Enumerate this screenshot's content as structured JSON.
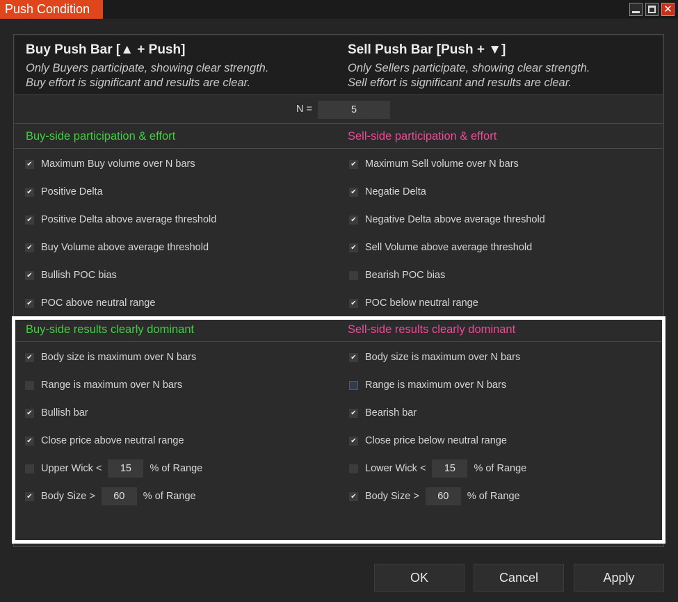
{
  "window": {
    "title": "Push Condition",
    "close_glyph": "✕"
  },
  "buy_header": {
    "title": "Buy Push Bar [▲ + Push]",
    "desc_line1": "Only Buyers participate, showing clear strength.",
    "desc_line2": "Buy effort is significant and results are clear."
  },
  "sell_header": {
    "title": "Sell Push Bar [Push + ▼]",
    "desc_line1": "Only Sellers participate, showing clear strength.",
    "desc_line2": "Sell effort is significant and results are clear."
  },
  "n_field": {
    "label": "N =",
    "value": "5"
  },
  "participation": {
    "buy_title": "Buy-side participation & effort",
    "sell_title": "Sell-side participation & effort",
    "buy_items": [
      {
        "label": "Maximum Buy volume over N bars",
        "checked": true
      },
      {
        "label": "Positive Delta",
        "checked": true
      },
      {
        "label": "Positive Delta above average threshold",
        "checked": true
      },
      {
        "label": "Buy Volume above average threshold",
        "checked": true
      },
      {
        "label": "Bullish POC bias",
        "checked": true
      },
      {
        "label": "POC above neutral range",
        "checked": true
      }
    ],
    "sell_items": [
      {
        "label": "Maximum Sell volume over N bars",
        "checked": true
      },
      {
        "label": "Negatie Delta",
        "checked": true
      },
      {
        "label": "Negative Delta above average threshold",
        "checked": true
      },
      {
        "label": "Sell Volume above average threshold",
        "checked": true
      },
      {
        "label": "Bearish POC bias",
        "checked": false
      },
      {
        "label": "POC below neutral range",
        "checked": true
      }
    ]
  },
  "results": {
    "buy_title": "Buy-side results clearly dominant",
    "sell_title": "Sell-side results clearly dominant",
    "buy_items": [
      {
        "label": "Body size is maximum over N bars",
        "checked": true
      },
      {
        "label": "Range is maximum over N bars",
        "checked": false
      },
      {
        "label": "Bullish bar",
        "checked": true
      },
      {
        "label": "Close price above neutral range",
        "checked": true
      }
    ],
    "sell_items": [
      {
        "label": "Body size is maximum over N bars",
        "checked": true
      },
      {
        "label": "Range is maximum over N bars",
        "checked": false
      },
      {
        "label": "Bearish bar",
        "checked": true
      },
      {
        "label": "Close price below neutral range",
        "checked": true
      }
    ],
    "buy_upper_wick": {
      "label": "Upper Wick <",
      "value": "15",
      "suffix": "% of Range",
      "checked": false
    },
    "buy_body_size": {
      "label": "Body Size >",
      "value": "60",
      "suffix": "% of Range",
      "checked": true
    },
    "sell_lower_wick": {
      "label": "Lower Wick <",
      "value": "15",
      "suffix": "% of Range",
      "checked": false
    },
    "sell_body_size": {
      "label": "Body Size >",
      "value": "60",
      "suffix": "% of Range",
      "checked": true
    }
  },
  "buttons": {
    "ok": "OK",
    "cancel": "Cancel",
    "apply": "Apply"
  },
  "check_glyph": "✔",
  "colors": {
    "title_tab": "#e0461c",
    "buy_accent": "#3fcf3f",
    "sell_accent": "#f0489a",
    "highlight": "#ffffff"
  }
}
